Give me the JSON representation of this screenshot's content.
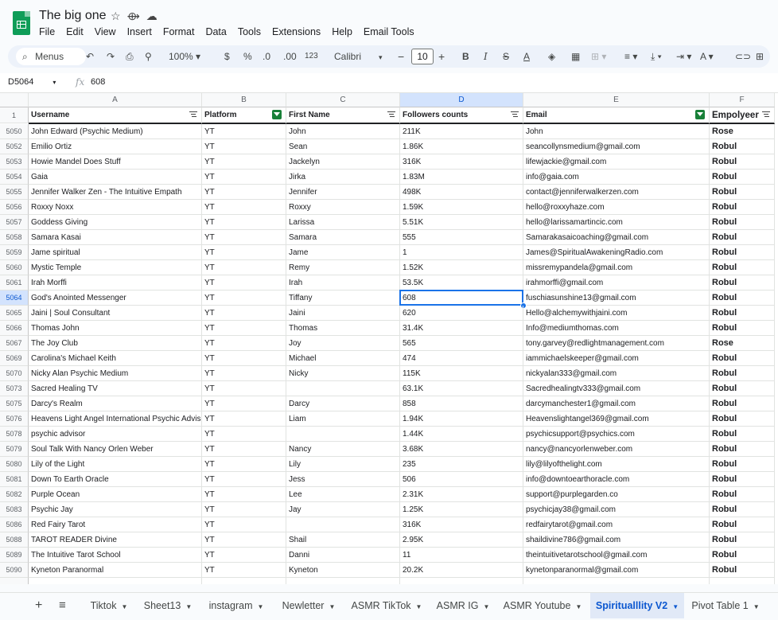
{
  "doc": {
    "title": "The big one"
  },
  "menu": [
    "File",
    "Edit",
    "View",
    "Insert",
    "Format",
    "Data",
    "Tools",
    "Extensions",
    "Help",
    "Email Tools"
  ],
  "toolbar": {
    "menus_label": "Menus",
    "zoom": "100%",
    "currency": "$",
    "percent": "%",
    "dec_decrease": ".0",
    "dec_increase": ".00",
    "number_format": "123",
    "font": "Calibri",
    "font_size": "10",
    "bold": "B",
    "italic": "I",
    "text_color": "A"
  },
  "formula": {
    "cell_ref": "D5064",
    "fx": "fx",
    "value": "608"
  },
  "columns": [
    {
      "letter": "A",
      "header": "Username"
    },
    {
      "letter": "B",
      "header": "Platform"
    },
    {
      "letter": "C",
      "header": "First Name"
    },
    {
      "letter": "D",
      "header": "Followers counts"
    },
    {
      "letter": "E",
      "header": "Email"
    },
    {
      "letter": "F",
      "header": "Empolyeer"
    }
  ],
  "header_row_num": "1",
  "rows": [
    [
      "5050",
      "John Edward (Psychic Medium)",
      "YT",
      "John",
      "211K",
      "John",
      "Rose"
    ],
    [
      "5052",
      "Emilio Ortiz",
      "YT",
      "Sean",
      "1.86K",
      "seancollynsmedium@gmail.com",
      "Robul"
    ],
    [
      "5053",
      "Howie Mandel Does Stuff",
      "YT",
      "Jackelyn",
      "316K",
      "lifewjackie@gmail.com",
      "Robul"
    ],
    [
      "5054",
      "Gaia",
      "YT",
      "Jirka",
      "1.83M",
      "info@gaia.com",
      "Robul"
    ],
    [
      "5055",
      "Jennifer Walker Zen - The Intuitive Empath",
      "YT",
      "Jennifer",
      "498K",
      "contact@jenniferwalkerzen.com",
      "Robul"
    ],
    [
      "5056",
      "Roxxy Noxx",
      "YT",
      "Roxxy",
      "1.59K",
      "hello@roxxyhaze.com",
      "Robul"
    ],
    [
      "5057",
      "Goddess Giving",
      "YT",
      "Larissa",
      "5.51K",
      "hello@larissamartincic.com",
      "Robul"
    ],
    [
      "5058",
      "Samara Kasai",
      "YT",
      "Samara",
      "555",
      "Samarakasaicoaching@gmail.com",
      "Robul"
    ],
    [
      "5059",
      "Jame spiritual",
      "YT",
      "Jame",
      "1",
      "James@SpiritualAwakeningRadio.com",
      "Robul"
    ],
    [
      "5060",
      "Mystic Temple",
      "YT",
      "Remy",
      "1.52K",
      "missremypandela@gmail.com",
      "Robul"
    ],
    [
      "5061",
      "Irah Morffi",
      "YT",
      "Irah",
      "53.5K",
      "irahmorffi@gmail.com",
      "Robul"
    ],
    [
      "5064",
      "God's Anointed Messenger",
      "YT",
      "Tiffany",
      "608",
      "fuschiasunshine13@gmail.com",
      "Robul"
    ],
    [
      "5065",
      "Jaini | Soul Consultant",
      "YT",
      "Jaini",
      "620",
      "Hello@alchemywithjaini.com",
      "Robul"
    ],
    [
      "5066",
      "Thomas John",
      "YT",
      "Thomas",
      "31.4K",
      "Info@mediumthomas.com",
      "Robul"
    ],
    [
      "5067",
      "The Joy Club",
      "YT",
      "Joy",
      "565",
      "tony.garvey@redlightmanagement.com",
      "Rose"
    ],
    [
      "5069",
      "Carolina's Michael Keith",
      "YT",
      "Michael",
      "474",
      "iammichaelskeeper@gmail.com",
      "Robul"
    ],
    [
      "5070",
      "Nicky Alan Psychic Medium",
      "YT",
      "Nicky",
      "115K",
      "nickyalan333@gmail.com",
      "Robul"
    ],
    [
      "5073",
      "Sacred Healing TV",
      "YT",
      "",
      "63.1K",
      "Sacredhealingtv333@gmail.com",
      "Robul"
    ],
    [
      "5075",
      "Darcy's Realm",
      "YT",
      "Darcy",
      "858",
      "darcymanchester1@gmail.com",
      "Robul"
    ],
    [
      "5076",
      "Heavens Light Angel International Psychic Advisor",
      "YT",
      "Liam",
      "1.94K",
      "Heavenslightangel369@gmail.com",
      "Robul"
    ],
    [
      "5078",
      "psychic advisor",
      "YT",
      "",
      "1.44K",
      "psychicsupport@psychics.com",
      "Robul"
    ],
    [
      "5079",
      "Soul Talk With Nancy Orlen Weber",
      "YT",
      "Nancy",
      "3.68K",
      "nancy@nancyorlenweber.com",
      "Robul"
    ],
    [
      "5080",
      "Lily of the Light",
      "YT",
      "Lily",
      "235",
      "lily@lilyofthelight.com",
      "Robul"
    ],
    [
      "5081",
      "Down To Earth Oracle",
      "YT",
      "Jess",
      "506",
      "info@downtoearthoracle.com",
      "Robul"
    ],
    [
      "5082",
      "Purple Ocean",
      "YT",
      "Lee",
      "2.31K",
      "support@purplegarden.co",
      "Robul"
    ],
    [
      "5083",
      "Psychic Jay",
      "YT",
      "Jay",
      "1.25K",
      "psychicjay38@gmail.com",
      "Robul"
    ],
    [
      "5086",
      "Red Fairy Tarot",
      "YT",
      "",
      "316K",
      "redfairytarot@gmail.com",
      "Robul"
    ],
    [
      "5088",
      "TAROT READER Divine",
      "YT",
      "Shail",
      "2.95K",
      "shaildivine786@gmail.com",
      "Robul"
    ],
    [
      "5089",
      "The Intuitive Tarot School",
      "YT",
      "Danni",
      "11",
      "theintuitivetarotschool@gmail.com",
      "Robul"
    ],
    [
      "5090",
      "Kyneton Paranormal",
      "YT",
      "Kyneton",
      "20.2K",
      "kynetonparanormal@gmail.com",
      "Robul"
    ]
  ],
  "selected_row": "5064",
  "selected_col": "D",
  "tabs": [
    {
      "label": "Tiktok"
    },
    {
      "label": "Sheet13"
    },
    {
      "label": "instagram"
    },
    {
      "label": "Newletter"
    },
    {
      "label": "ASMR TikTok"
    },
    {
      "label": "ASMR IG"
    },
    {
      "label": "ASMR Youtube"
    },
    {
      "label": "Spiritualllity V2",
      "active": true
    },
    {
      "label": "Pivot Table 1"
    }
  ],
  "icons": [
    "star-icon",
    "move-icon",
    "cloud-icon",
    "search-icon",
    "undo-icon",
    "redo-icon",
    "print-icon",
    "paint-format-icon",
    "filter-icon",
    "add-sheet-icon",
    "all-sheets-icon"
  ],
  "colors": {
    "accent": "#0b57d0",
    "selection": "#1a73e8",
    "filter_active": "#188038",
    "sheets_green": "#0f9d58"
  }
}
